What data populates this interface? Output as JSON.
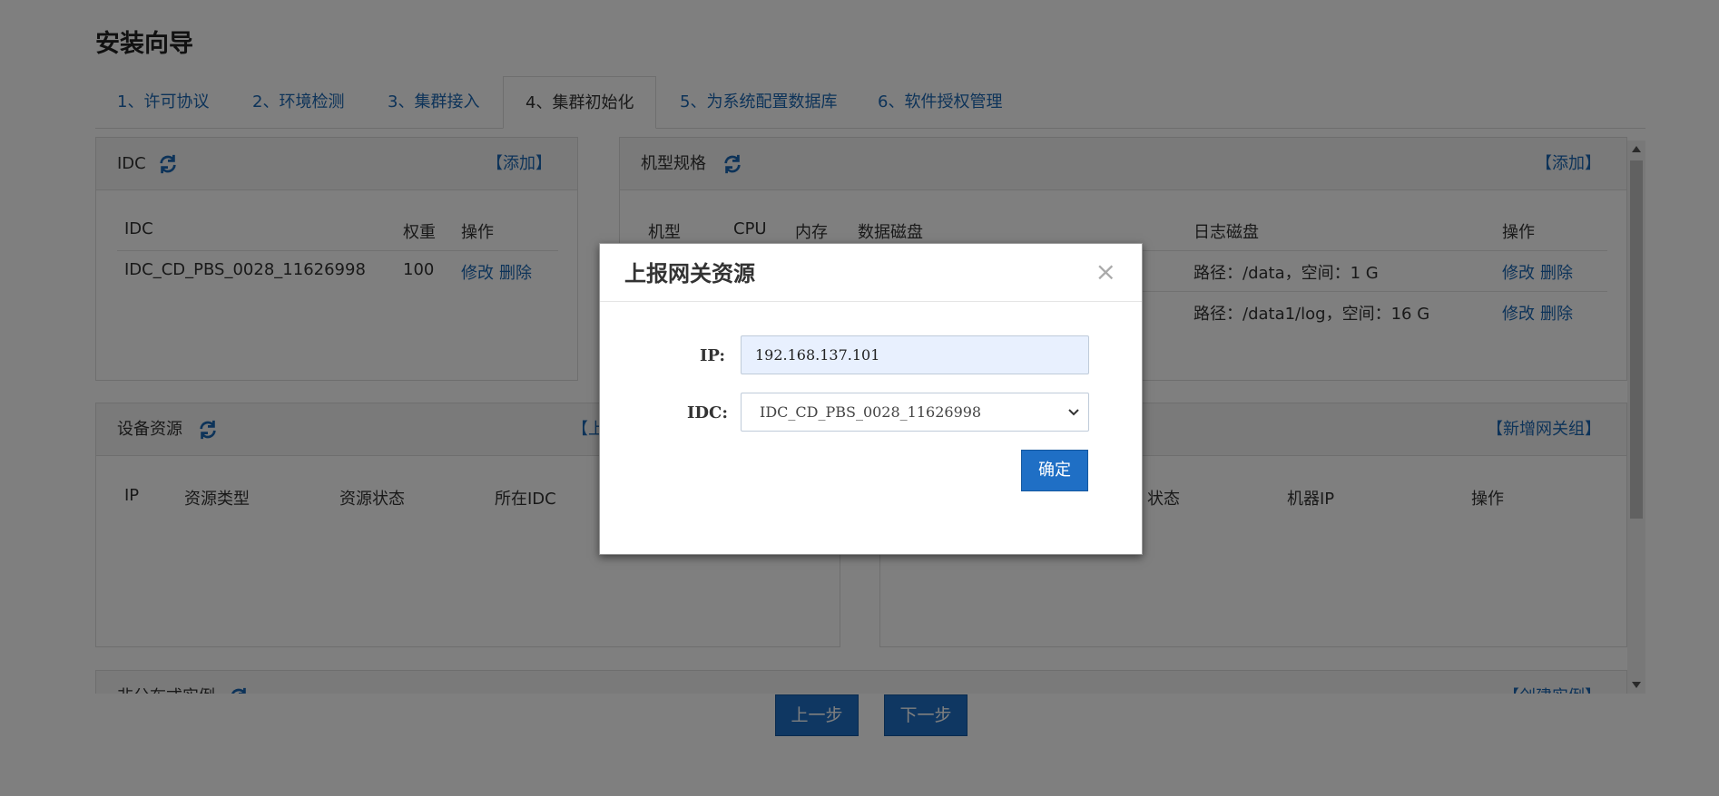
{
  "page": {
    "title": "安装向导"
  },
  "tabs": [
    {
      "label": "1、许可协议"
    },
    {
      "label": "2、环境检测"
    },
    {
      "label": "3、集群接入"
    },
    {
      "label": "4、集群初始化"
    },
    {
      "label": "5、为系统配置数据库"
    },
    {
      "label": "6、软件授权管理"
    }
  ],
  "idc_panel": {
    "title": "IDC",
    "add_label": "【添加】",
    "columns": [
      "IDC",
      "权重",
      "操作"
    ],
    "rows": [
      {
        "idc": "IDC_CD_PBS_0028_11626998",
        "weight": "100",
        "edit": "修改",
        "delete": "删除"
      }
    ]
  },
  "spec_panel": {
    "title": "机型规格",
    "add_label": "【添加】",
    "columns": [
      "机型",
      "CPU",
      "内存",
      "数据磁盘",
      "日志磁盘",
      "操作"
    ],
    "rows": [
      {
        "log_disk": "路径：/data，空间：1 G",
        "edit": "修改",
        "delete": "删除"
      },
      {
        "log_disk": "路径：/data1/log，空间：16 G",
        "edit": "修改",
        "delete": "删除"
      }
    ]
  },
  "device_panel": {
    "title": "设备资源",
    "action_partial": "【上",
    "columns": [
      "IP",
      "资源类型",
      "资源状态",
      "所在IDC"
    ]
  },
  "gateway_panel": {
    "action_label": "【新增网关组】",
    "columns": [
      "状态",
      "机器IP",
      "操作"
    ]
  },
  "instance_panel": {
    "title": "非分布式实例",
    "action_label": "【创建实例】"
  },
  "footer": {
    "prev_label": "上一步",
    "next_label": "下一步"
  },
  "modal": {
    "title": "上报网关资源",
    "close_glyph": "×",
    "ip_label": "IP:",
    "ip_value": "192.168.137.101",
    "idc_label": "IDC:",
    "idc_selected": "IDC_CD_PBS_0028_11626998",
    "confirm_label": "确定"
  },
  "colors": {
    "link": "#1a66b3",
    "primary_button": "#1f6fc5",
    "overlay": "rgba(0,0,0,0.5)"
  }
}
